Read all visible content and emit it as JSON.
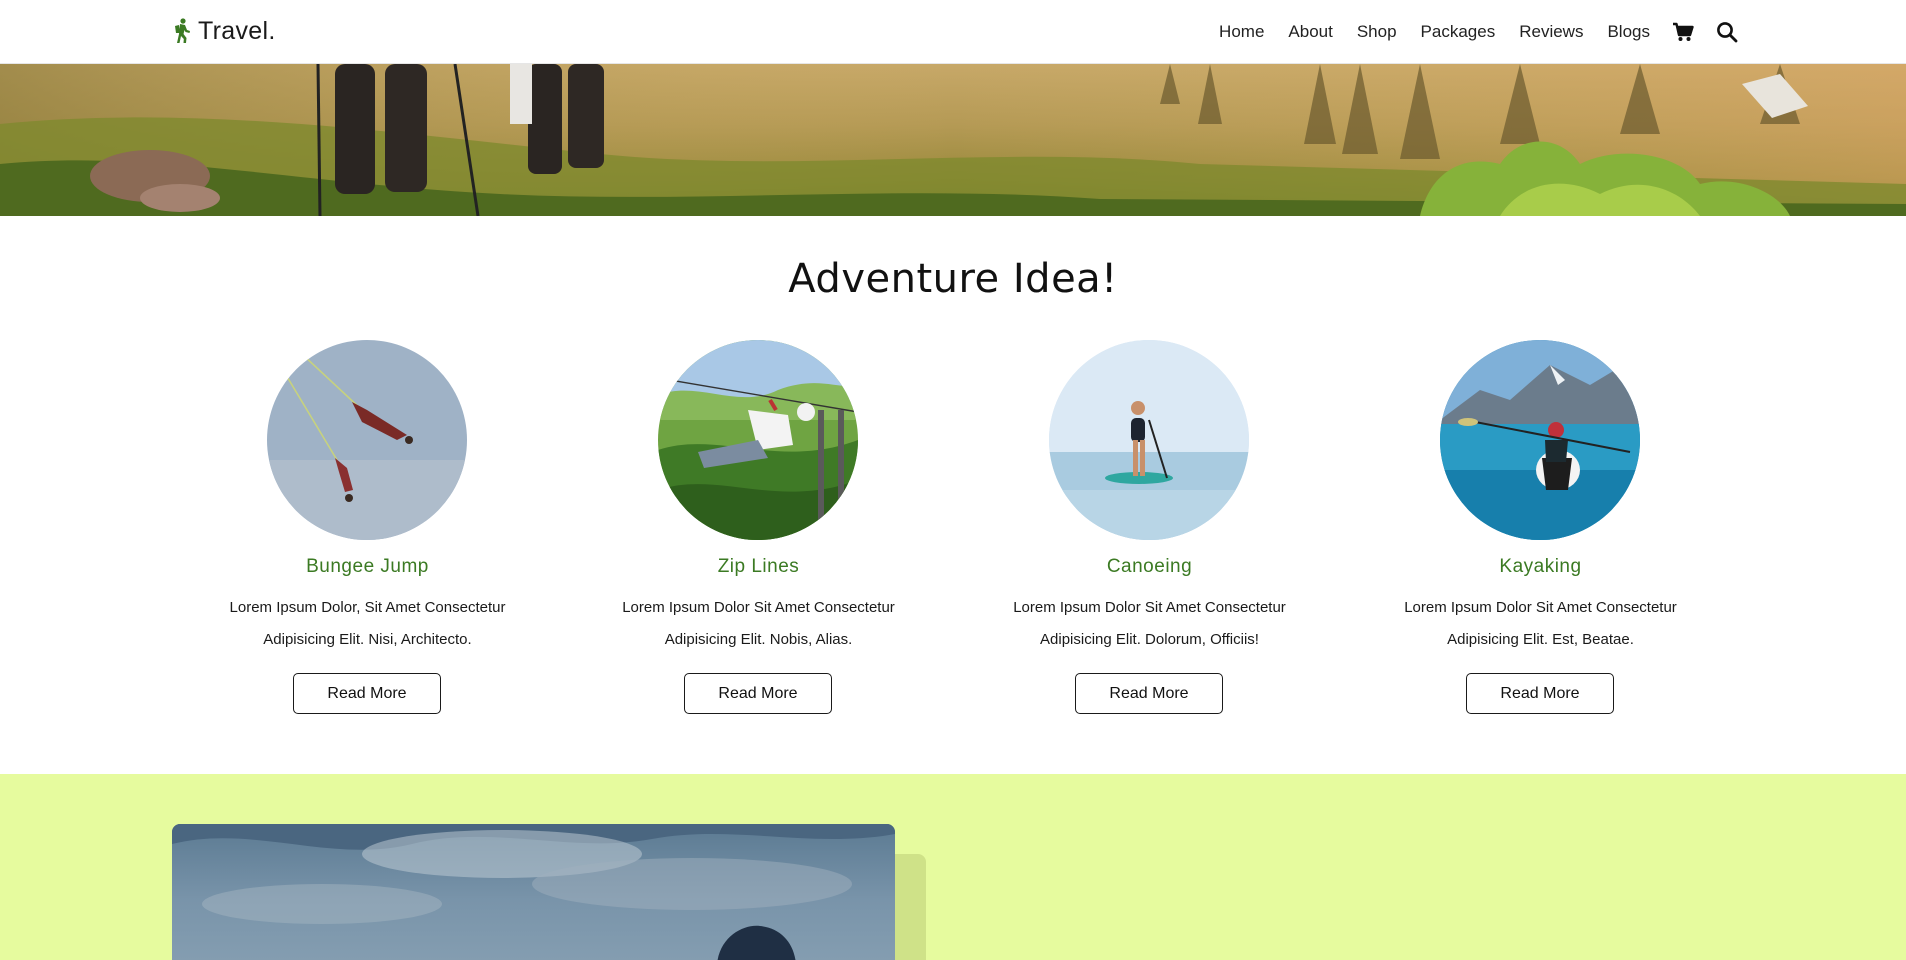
{
  "header": {
    "logo_text": "Travel.",
    "logo_icon": "hiker-icon",
    "nav": [
      "Home",
      "About",
      "Shop",
      "Packages",
      "Reviews",
      "Blogs"
    ],
    "icons": [
      "cart-icon",
      "search-icon"
    ],
    "brand_color": "#3b7a23"
  },
  "adventure": {
    "title": "Adventure Idea!",
    "cards": [
      {
        "title": "Bungee Jump",
        "description": "Lorem Ipsum Dolor, Sit Amet Consectetur Adipisicing Elit. Nisi, Architecto.",
        "button": "Read More"
      },
      {
        "title": "Zip Lines",
        "description": "Lorem Ipsum Dolor Sit Amet Consectetur Adipisicing Elit. Nobis, Alias.",
        "button": "Read More"
      },
      {
        "title": "Canoeing",
        "description": "Lorem Ipsum Dolor Sit Amet Consectetur Adipisicing Elit. Dolorum, Officiis!",
        "button": "Read More"
      },
      {
        "title": "Kayaking",
        "description": "Lorem Ipsum Dolor Sit Amet Consectetur Adipisicing Elit. Est, Beatae.",
        "button": "Read More"
      }
    ]
  },
  "lower": {
    "background_color": "#e6fb9e"
  }
}
